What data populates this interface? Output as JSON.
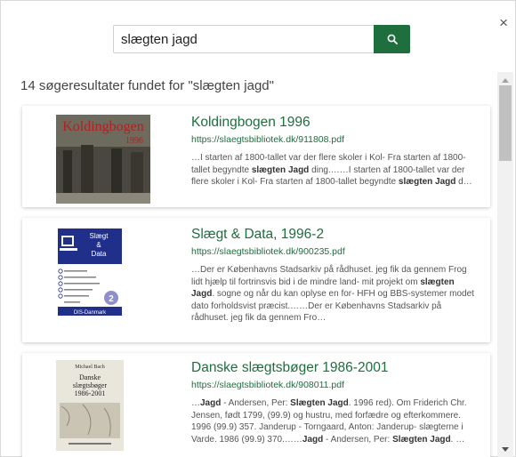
{
  "dialog": {
    "close_label": "×"
  },
  "search": {
    "value": "slægten jagd",
    "button_icon": "search-icon"
  },
  "results_summary": "14 søgeresultater fundet for \"slægten jagd\"",
  "results": [
    {
      "title": "Koldingbogen 1996",
      "url": "https://slaegtsbibliotek.dk/911808.pdf",
      "thumbnail": {
        "kind": "photo-cover",
        "cover_title": "Koldingbogen",
        "cover_year": "1996",
        "accent": "#b32020"
      },
      "snippet": [
        {
          "t": "…I starten af 1800-tallet var der flere skoler i Kol- Fra starten af 1800-tallet begyndte "
        },
        {
          "t": "slægten Jagd",
          "b": true
        },
        {
          "t": " ding.……I starten af 1800-tallet var der flere skoler i Kol- Fra starten af 1800-tallet begyndte "
        },
        {
          "t": "slægten Jagd",
          "b": true
        },
        {
          "t": " d…"
        }
      ]
    },
    {
      "title": "Slægt & Data, 1996-2",
      "url": "https://slaegtsbibliotek.dk/900235.pdf",
      "thumbnail": {
        "kind": "magazine-cover",
        "cover_title_1": "Slægt",
        "cover_title_2": "&",
        "cover_title_3": "Data",
        "cover_number": "2",
        "cover_footer": "DIS-Danmark",
        "accent": "#1f2f8a"
      },
      "snippet": [
        {
          "t": "…Der er Københavns Stadsarkiv på rådhuset. jeg fik da gennem Frog lidt hjælp til fortrinsvis bid i de mindre land- mit projekt om "
        },
        {
          "t": "slægten Jagd",
          "b": true
        },
        {
          "t": ". sogne og når du kan oplyse en for- HFH og BBS-systemer modet dato forholdsvist præcist.……Der er Københavns Stadsarkiv på rådhuset. jeg fik da gennem Fro…"
        }
      ]
    },
    {
      "title": "Danske slægtsbøger 1986-2001",
      "url": "https://slaegtsbibliotek.dk/908011.pdf",
      "thumbnail": {
        "kind": "book-cover",
        "cover_author": "Michael Bach",
        "cover_title_1": "Danske",
        "cover_title_2": "slægtsbøger",
        "cover_title_3": "1986-2001"
      },
      "snippet": [
        {
          "t": "…"
        },
        {
          "t": "Jagd",
          "b": true
        },
        {
          "t": " - Andersen, Per: "
        },
        {
          "t": "Slægten Jagd",
          "b": true
        },
        {
          "t": ". 1996 red). Om Friderich Chr. Jensen, født 1799, (99.9) og hustru, med forfædre og efterkommere. 1996 (99.9) 357. Janderup - Torngaard, Anton: Janderup- slægterne i Varde. 1986 (99.9) 370.……"
        },
        {
          "t": "Jagd",
          "b": true
        },
        {
          "t": " - Andersen, Per: "
        },
        {
          "t": "Slægten Jagd",
          "b": true
        },
        {
          "t": ". …"
        }
      ]
    }
  ],
  "colors": {
    "accent": "#1e6e3e",
    "link": "#1e6e3e",
    "text": "#555555"
  }
}
